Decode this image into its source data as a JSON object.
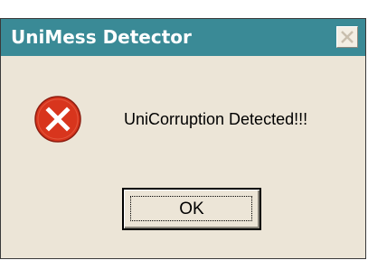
{
  "dialog": {
    "title": "UniMess Detector",
    "message": "UniCorruption Detected!!!",
    "icon": "error-icon",
    "ok_label": "OK",
    "close_icon": "close-icon"
  },
  "colors": {
    "titlebar": "#3a8a96",
    "dialog_background": "#ece5d7",
    "error_red": "#d8351d"
  }
}
